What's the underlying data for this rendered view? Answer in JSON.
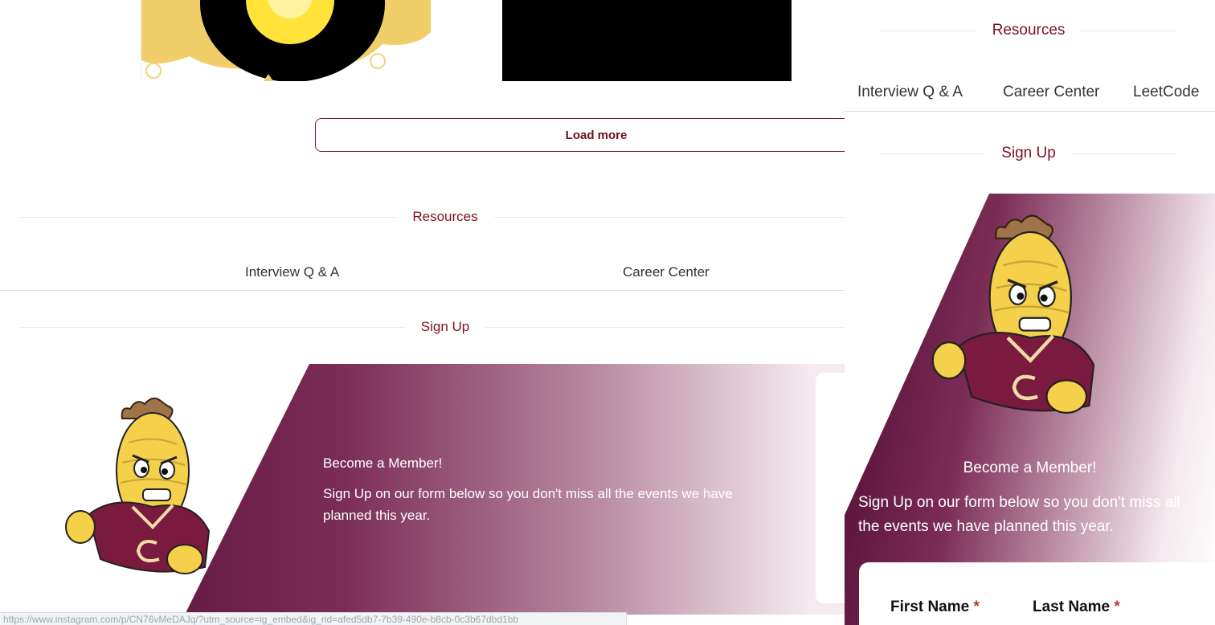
{
  "load_more": {
    "label": "Load more"
  },
  "resources": {
    "heading": "Resources",
    "links": [
      "Interview Q & A",
      "Career Center",
      "LeetCode"
    ]
  },
  "signup": {
    "heading": "Sign Up",
    "banner_title": "Become a Member!",
    "banner_text": "Sign Up on our form below so you don't miss all the events we have planned this year."
  },
  "form": {
    "first_name_label": "First Name",
    "last_name_label": "Last Name",
    "required_mark": "*"
  },
  "status_bar": {
    "url": "https://www.instagram.com/p/CN76vMeDAJq/?utm_source=ig_embed&ig_rid=afed5db7-7b39-490e-b8cb-0c3b67dbd1bb"
  },
  "colors": {
    "brand_maroon": "#6b1020",
    "gradient_dark": "#4e0a30",
    "mascot_yellow": "#f5d04a"
  }
}
